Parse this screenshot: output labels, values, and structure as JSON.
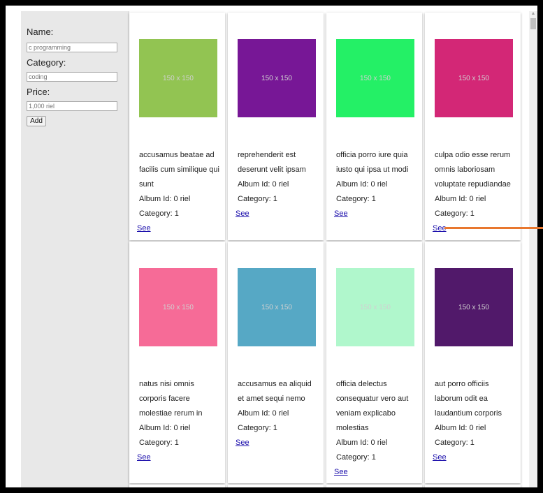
{
  "form": {
    "name_label": "Name:",
    "name_value": "c programming",
    "category_label": "Category:",
    "category_value": "coding",
    "price_label": "Price:",
    "price_value": "1,000 riel",
    "add_label": "Add"
  },
  "cards": [
    {
      "img": "150 x 150",
      "color": "#92c452",
      "lines": [
        "accusamus beatae ad",
        "facilis cum similique qui",
        "sunt",
        "Album Id: 0 riel",
        "Category: 1"
      ],
      "link": "See"
    },
    {
      "img": "150 x 150",
      "color": "#771796",
      "lines": [
        "reprehenderit est",
        "deserunt velit ipsam",
        "Album Id: 0 riel",
        "Category: 1"
      ],
      "link": "See"
    },
    {
      "img": "150 x 150",
      "color": "#24f066",
      "lines": [
        "officia porro iure quia",
        "iusto qui ipsa ut modi",
        "Album Id: 0 riel",
        "Category: 1"
      ],
      "link": "See"
    },
    {
      "img": "150 x 150",
      "color": "#d32776",
      "lines": [
        "culpa odio esse rerum",
        "omnis laboriosam",
        "voluptate repudiandae",
        "Album Id: 0 riel",
        "Category: 1"
      ],
      "link": "See"
    },
    {
      "img": "150 x 150",
      "color": "#f66b97",
      "lines": [
        "natus nisi omnis",
        "corporis facere",
        "molestiae rerum in",
        "Album Id: 0 riel",
        "Category: 1"
      ],
      "link": "See"
    },
    {
      "img": "150 x 150",
      "color": "#56a8c5",
      "lines": [
        "accusamus ea aliquid",
        "et amet sequi nemo",
        "Album Id: 0 riel",
        "Category: 1"
      ],
      "link": "See"
    },
    {
      "img": "150 x 150",
      "color": "#b0f7cc",
      "lines": [
        "officia delectus",
        "consequatur vero aut",
        "veniam explicabo",
        "molestias",
        "Album Id: 0 riel",
        "Category: 1"
      ],
      "link": "See"
    },
    {
      "img": "150 x 150",
      "color": "#51196a",
      "lines": [
        "aut porro officiis",
        "laborum odit ea",
        "laudantium corporis",
        "Album Id: 0 riel",
        "Category: 1"
      ],
      "link": "See"
    }
  ]
}
